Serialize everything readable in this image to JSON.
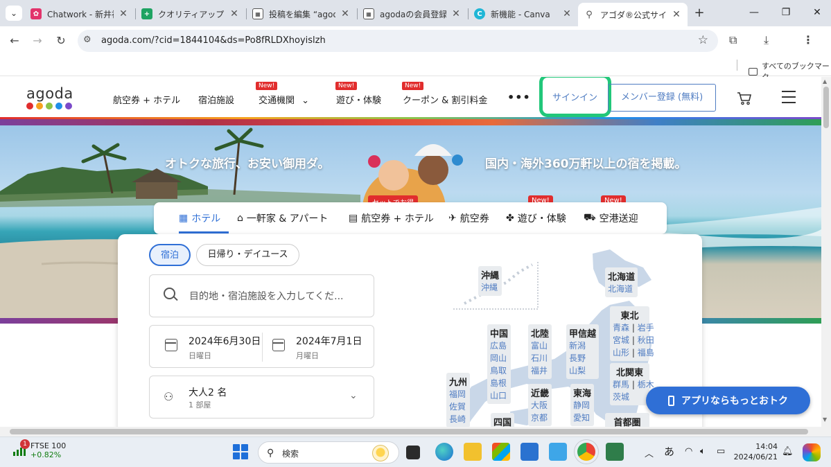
{
  "browser": {
    "tabs": [
      {
        "title": "Chatwork - 新井祐",
        "favicon_color": "#e2336b"
      },
      {
        "title": "クオリティアップリスト",
        "favicon_color": "#1ea362"
      },
      {
        "title": "投稿を編集 “agoda",
        "favicon_color": "#333333"
      },
      {
        "title": "agodaの会員登録ブ",
        "favicon_color": "#333333"
      },
      {
        "title": "新機能 - Canva",
        "favicon_color": "#1fb6d6"
      },
      {
        "title": "アゴダ®公式サイト|",
        "favicon_color": "#555555",
        "active": true
      }
    ],
    "url": "agoda.com/?cid=1844104&ds=Po8fRLDXhoyislzh",
    "bookmarks_folder": "すべてのブックマーク"
  },
  "site": {
    "logo_text": "agoda",
    "logo_colors": [
      "#e12d2d",
      "#f6a21e",
      "#8bc34a",
      "#1f8fe8",
      "#7b4ac9"
    ],
    "nav": [
      {
        "label": "航空券 + ホテル",
        "badge": ""
      },
      {
        "label": "宿泊施設",
        "badge": ""
      },
      {
        "label": "交通機関",
        "badge": "New!"
      },
      {
        "label": "遊び・体験",
        "badge": "New!"
      },
      {
        "label": "クーポン & 割引料金",
        "badge": "New!"
      }
    ],
    "more": "•••",
    "signin": "サインイン",
    "register": "メンバー登録 (無料)"
  },
  "hero": {
    "left_text": "オトクな旅行、お安い御用ダ。",
    "right_text": "国内・海外360万軒以上の宿を掲載。"
  },
  "product_tabs": {
    "set_badge": "セットでお得",
    "new_badge": "New!",
    "items": [
      {
        "label": "ホテル",
        "icon": "hotel-icon",
        "active": true
      },
      {
        "label": "一軒家 & アパート",
        "icon": "house-icon"
      },
      {
        "label": "航空券 + ホテル",
        "icon": "flight-hotel-icon"
      },
      {
        "label": "航空券",
        "icon": "plane-icon"
      },
      {
        "label": "遊び・体験",
        "icon": "activity-icon"
      },
      {
        "label": "空港送迎",
        "icon": "car-icon"
      }
    ]
  },
  "search": {
    "mode_stay": "宿泊",
    "mode_day": "日帰り・デイユース",
    "placeholder": "目的地・宿泊施設を入力してくだ...",
    "checkin_date": "2024年6月30日",
    "checkin_day": "日曜日",
    "checkout_date": "2024年7月1日",
    "checkout_day": "月曜日",
    "guests": "大人2 名",
    "rooms": "1 部屋"
  },
  "map": {
    "okinawa": {
      "name": "沖縄",
      "prefs": [
        "沖縄"
      ]
    },
    "hokkaido": {
      "name": "北海道",
      "prefs": [
        "北海道"
      ]
    },
    "tohoku": {
      "name": "東北",
      "rows": [
        "青森",
        "岩手",
        "宮城",
        "秋田",
        "山形",
        "福島"
      ]
    },
    "chugoku": {
      "name": "中国",
      "prefs": [
        "広島",
        "岡山",
        "鳥取",
        "島根",
        "山口"
      ]
    },
    "hokuriku": {
      "name": "北陸",
      "prefs": [
        "富山",
        "石川",
        "福井"
      ]
    },
    "koshinetsu": {
      "name": "甲信越",
      "prefs": [
        "新潟",
        "長野",
        "山梨"
      ]
    },
    "kitakanto": {
      "name": "北関東",
      "rows": [
        "群馬",
        "栃木",
        "茨城"
      ]
    },
    "kyushu": {
      "name": "九州",
      "prefs": [
        "福岡",
        "佐賀",
        "長崎"
      ]
    },
    "kinki": {
      "name": "近畿",
      "prefs": [
        "大阪",
        "京都"
      ]
    },
    "tokai": {
      "name": "東海",
      "prefs": [
        "静岡",
        "愛知"
      ]
    },
    "shikoku": {
      "name": "四国",
      "prefs": []
    },
    "shutoken": {
      "name": "首都圏",
      "prefs": []
    }
  },
  "app_banner": "アプリならもっとおトク",
  "taskbar": {
    "stock_name": "FTSE 100",
    "stock_change": "+0.82%",
    "notification_count": "1",
    "search_label": "検索",
    "ime": "あ",
    "time": "14:04",
    "date": "2024/06/21"
  }
}
